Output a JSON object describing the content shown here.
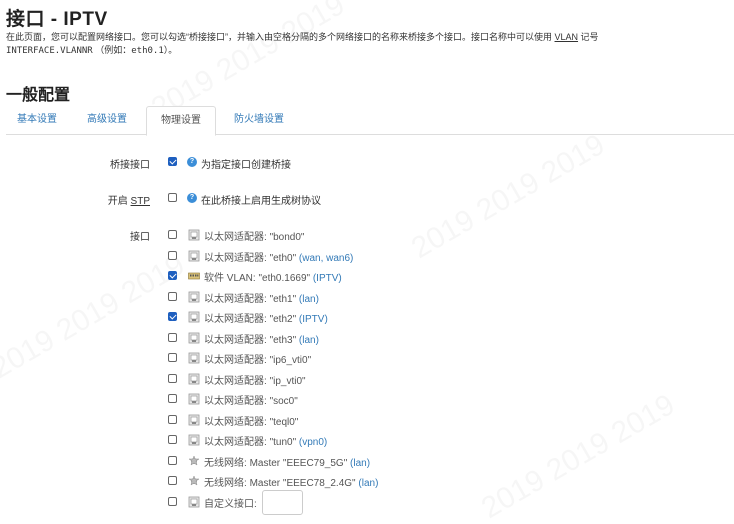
{
  "header": {
    "title": "接口 - IPTV",
    "desc_line1": "在此页面，您可以配置网络接口。您可以勾选“桥接接口”，并输入由空格分隔的多个网络接口的名称来桥接多个接口。接口名称中可以使用",
    "desc_vlan": "VLAN",
    "desc_line1_end": "记号",
    "desc_line2_mono": "INTERFACE.VLANNR",
    "desc_line2_rest": "（例如：",
    "desc_line2_example": "eth0.1",
    "desc_line2_end": "）。"
  },
  "section": {
    "title": "一般配置"
  },
  "tabs": [
    {
      "label": "基本设置",
      "active": false
    },
    {
      "label": "高级设置",
      "active": false
    },
    {
      "label": "物理设置",
      "active": true
    },
    {
      "label": "防火墙设置",
      "active": false
    }
  ],
  "bridge": {
    "label": "桥接接口",
    "checked": true,
    "help": "为指定接口创建桥接"
  },
  "stp": {
    "label_prefix": "开启",
    "label_abbr": "STP",
    "checked": false,
    "help": "在此桥接上启用生成树协议"
  },
  "interfaces": {
    "label": "接口",
    "items": [
      {
        "icon": "ethernet-icon",
        "prefix": "以太网适配器: ",
        "name": "\"bond0\"",
        "networks": "",
        "checked": false
      },
      {
        "icon": "ethernet-icon",
        "prefix": "以太网适配器: ",
        "name": "\"eth0\"",
        "networks": "(wan, wan6)",
        "checked": false
      },
      {
        "icon": "vlan-icon",
        "prefix": "软件 VLAN: ",
        "name": "\"eth0.1669\"",
        "networks": "(IPTV)",
        "checked": true
      },
      {
        "icon": "ethernet-icon",
        "prefix": "以太网适配器: ",
        "name": "\"eth1\"",
        "networks": "(lan)",
        "checked": false
      },
      {
        "icon": "ethernet-icon",
        "prefix": "以太网适配器: ",
        "name": "\"eth2\"",
        "networks": "(IPTV)",
        "checked": true
      },
      {
        "icon": "ethernet-icon",
        "prefix": "以太网适配器: ",
        "name": "\"eth3\"",
        "networks": "(lan)",
        "checked": false
      },
      {
        "icon": "ethernet-icon",
        "prefix": "以太网适配器: ",
        "name": "\"ip6_vti0\"",
        "networks": "",
        "checked": false
      },
      {
        "icon": "ethernet-icon",
        "prefix": "以太网适配器: ",
        "name": "\"ip_vti0\"",
        "networks": "",
        "checked": false
      },
      {
        "icon": "ethernet-icon",
        "prefix": "以太网适配器: ",
        "name": "\"soc0\"",
        "networks": "",
        "checked": false
      },
      {
        "icon": "ethernet-icon",
        "prefix": "以太网适配器: ",
        "name": "\"teql0\"",
        "networks": "",
        "checked": false
      },
      {
        "icon": "ethernet-icon",
        "prefix": "以太网适配器: ",
        "name": "\"tun0\"",
        "networks": "(vpn0)",
        "checked": false
      },
      {
        "icon": "wifi-icon",
        "prefix": "无线网络: ",
        "name": "Master \"EEEC79_5G\"",
        "networks": "(lan)",
        "checked": false
      },
      {
        "icon": "wifi-icon",
        "prefix": "无线网络: ",
        "name": "Master \"EEEC78_2.4G\"",
        "networks": "(lan)",
        "checked": false
      }
    ],
    "custom": {
      "label": "自定义接口:",
      "value": "",
      "checked": false
    }
  }
}
